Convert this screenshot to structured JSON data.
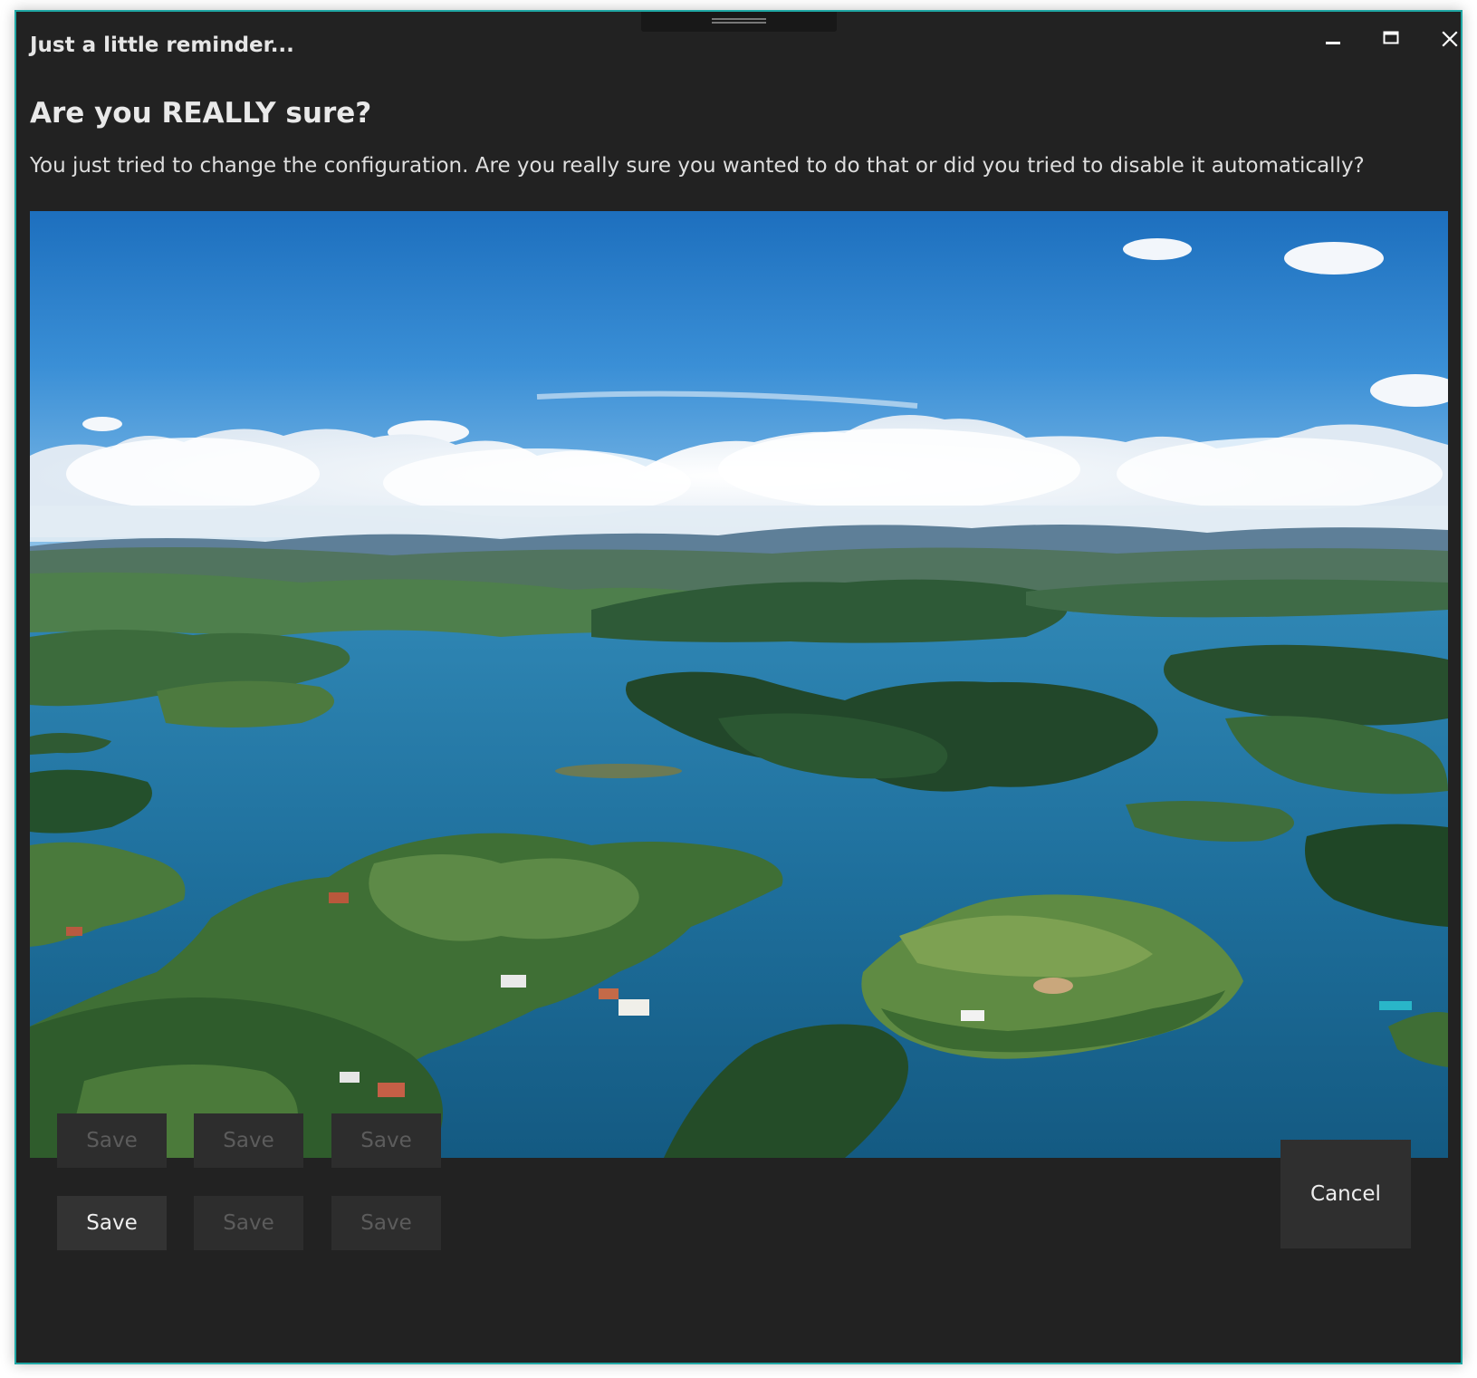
{
  "window": {
    "title": "Just a little reminder...",
    "accent_color": "#1fa7a4",
    "background_color": "#222222",
    "controls": {
      "minimize_icon": "minimize-icon",
      "maximize_icon": "maximize-icon",
      "close_icon": "close-icon"
    }
  },
  "dialog": {
    "heading": "Are you REALLY sure?",
    "message": "You just tried to change the configuration. Are you really sure you wanted to do that or did you tried to disable it automatically?",
    "image": "lake-islands-landscape-photo"
  },
  "buttons": {
    "grid": [
      [
        {
          "label": "Save",
          "enabled": false
        },
        {
          "label": "Save",
          "enabled": false
        },
        {
          "label": "Save",
          "enabled": false
        }
      ],
      [
        {
          "label": "Save",
          "enabled": true
        },
        {
          "label": "Save",
          "enabled": false
        },
        {
          "label": "Save",
          "enabled": false
        }
      ]
    ],
    "cancel_label": "Cancel"
  }
}
